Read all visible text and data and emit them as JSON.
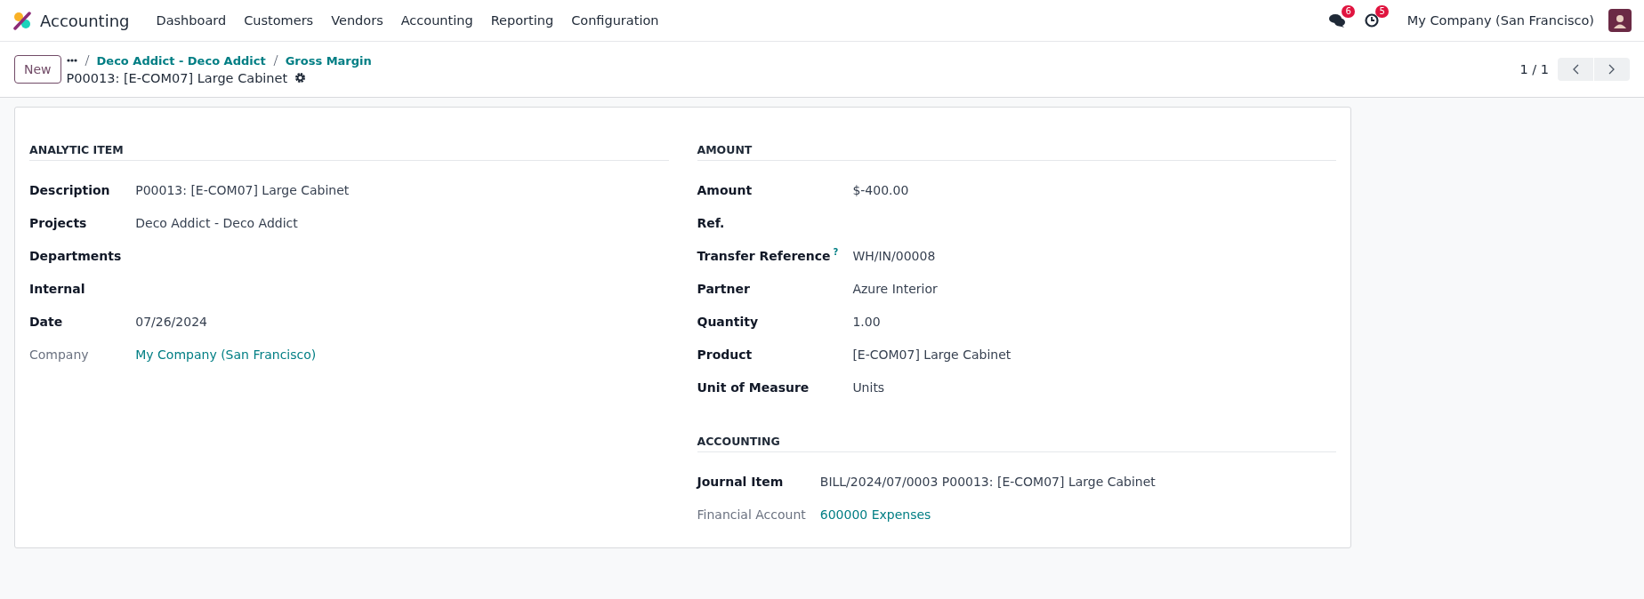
{
  "navbar": {
    "app_name": "Accounting",
    "menu": [
      "Dashboard",
      "Customers",
      "Vendors",
      "Accounting",
      "Reporting",
      "Configuration"
    ],
    "messages_count": "6",
    "activities_count": "5",
    "company": "My Company (San Francisco)"
  },
  "control_panel": {
    "new_button": "New",
    "breadcrumbs": [
      "Deco Addict - Deco Addict",
      "Gross Margin"
    ],
    "record_title": "P00013: [E-COM07] Large Cabinet",
    "pager": "1 / 1"
  },
  "columns": [
    {
      "sections": [
        {
          "title": "ANALYTIC ITEM",
          "fields": [
            {
              "label": "Description",
              "value": "P00013: [E-COM07] Large Cabinet",
              "kind": "plain"
            },
            {
              "label": "Projects",
              "value": "Deco Addict - Deco Addict",
              "kind": "plain"
            },
            {
              "label": "Departments",
              "kind": "plain"
            },
            {
              "label": "Internal",
              "kind": "plain"
            },
            {
              "label": "Date",
              "value": "07/26/2024",
              "kind": "plain"
            },
            {
              "label": "Company",
              "value": "My Company (San Francisco)",
              "kind": "link"
            }
          ]
        }
      ]
    },
    {
      "sections": [
        {
          "title": "AMOUNT",
          "fields": [
            {
              "label": "Amount",
              "value": "$-400.00",
              "kind": "plain"
            },
            {
              "label": "Ref.",
              "kind": "plain"
            },
            {
              "label": "Transfer Reference",
              "help": "?",
              "value": "WH/IN/00008",
              "kind": "plain"
            },
            {
              "label": "Partner",
              "value": "Azure Interior",
              "kind": "plain"
            },
            {
              "label": "Quantity",
              "value": "1.00",
              "kind": "plain"
            },
            {
              "label": "Product",
              "value": "[E-COM07] Large Cabinet",
              "kind": "plain"
            },
            {
              "label": "Unit of Measure",
              "value": "Units",
              "kind": "plain"
            }
          ]
        },
        {
          "title": "ACCOUNTING",
          "fields": [
            {
              "label": "Journal Item",
              "value": "BILL/2024/07/0003 P00013: [E-COM07] Large Cabinet",
              "kind": "plain"
            },
            {
              "label": "Financial Account",
              "value": "600000 Expenses",
              "kind": "link"
            }
          ]
        }
      ]
    }
  ]
}
